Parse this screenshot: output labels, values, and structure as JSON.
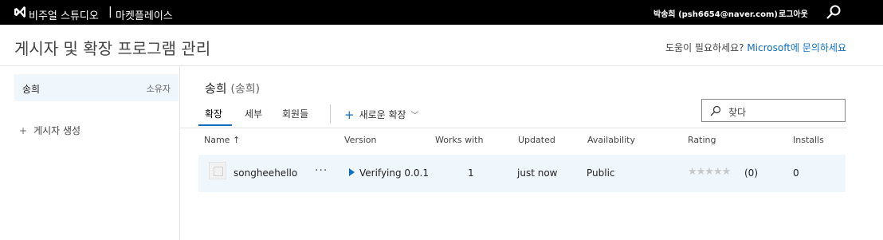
{
  "topbar": {
    "brand": "비주얼 스튜디오",
    "separator": "|",
    "section": "마켓플레이스",
    "user": "박송희 (psh6654@naver.com)",
    "logout": "로그아웃"
  },
  "header": {
    "title": "게시자 및 확장 프로그램 관리",
    "help_prefix": "도움이 필요하세요? ",
    "help_link": "Microsoft에 문의하세요"
  },
  "sidebar": {
    "publisher_name": "송희",
    "publisher_role": "소유자",
    "create_label": "게시자 생성"
  },
  "main": {
    "publisher_title": "송희",
    "publisher_title_paren": "(송희)",
    "tabs": [
      {
        "label": "확장",
        "active": true
      },
      {
        "label": "세부",
        "active": false
      },
      {
        "label": "회원들",
        "active": false
      }
    ],
    "new_extension_label": "새로운 확장",
    "search_placeholder": "찾다",
    "columns": [
      "Name ↑",
      "Version",
      "Works with",
      "Updated",
      "Availability",
      "Rating",
      "Installs"
    ],
    "rows": [
      {
        "name": "songheehello",
        "more": "···",
        "version": "Verifying 0.0.1",
        "works_with": "1",
        "updated": "just now",
        "availability": "Public",
        "rating_stars": "★★★★★",
        "rating_count": "(0)",
        "installs": "0"
      }
    ]
  },
  "colors": {
    "topbar_bg": "#000000",
    "accent": "#106ebe",
    "selected_bg": "#eff6fc"
  }
}
